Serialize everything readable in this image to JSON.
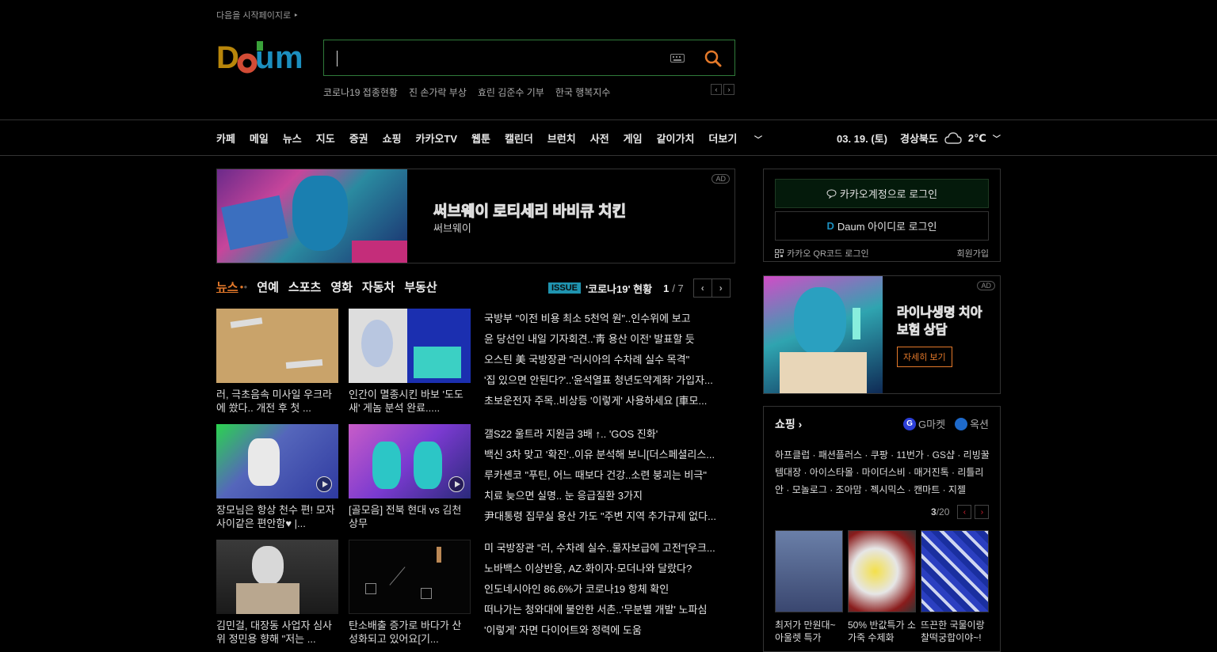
{
  "top": {
    "homepage_link": "다음을 시작페이지로",
    "search": {
      "placeholder": ""
    },
    "trending": [
      "코로나19 접종현황",
      "진 손가락 부상",
      "효린 김준수 기부",
      "한국 행복지수"
    ]
  },
  "gnb": {
    "menu": [
      "카페",
      "메일",
      "뉴스",
      "지도",
      "증권",
      "쇼핑",
      "카카오TV",
      "웹툰",
      "캘린더",
      "브런치",
      "사전",
      "게임",
      "같이가치",
      "더보기"
    ],
    "date": "03. 19. (토)",
    "region": "경상북도",
    "temperature": "2℃"
  },
  "ad_banner": {
    "badge": "AD",
    "title": "써브웨이 로티세리 바비큐 치킨",
    "sponsor": "써브웨이"
  },
  "news": {
    "tabs": [
      "뉴스",
      "연예",
      "스포츠",
      "영화",
      "자동차",
      "부동산"
    ],
    "issue_badge": "ISSUE",
    "issue_title": "'코로나19' 현황",
    "issue_page": "1",
    "issue_total": "/ 7",
    "thumbs": [
      "러, 극초음속 미사일 우크라에 쐈다.. 개전 후 첫 ...",
      "인간이 멸종시킨 바보 '도도새' 게놈 분석 완료.....",
      "장모님은 항상 천수 편! 모자사이같은 편안함♥ |...",
      "[골모음] 전북 현대 vs 김천 상무",
      "김민걸, 대장동 사업자 심사위 정민용 향해 \"저는 ...",
      "탄소배출 증가로 바다가 산성화되고 있어요[기..."
    ],
    "headlines": [
      [
        "국방부 \"이전 비용 최소 5천억 원\"..인수위에 보고",
        "윤 당선인 내일 기자회견..'靑 용산 이전' 발표할 듯",
        "오스틴 美 국방장관 \"러시아의 수차례 실수 목격\"",
        "'집 있으면 안된다?'..'윤석열표 청년도약계좌' 가입자...",
        "초보운전자 주목..비상등 '이렇게' 사용하세요 [車모..."
      ],
      [
        "갤S22 울트라 지원금 3배 ↑.. 'GOS 진화'",
        "백신 3차 맞고 '확진'..이유 분석해 보니[더스페셜리스...",
        "루카셴코 \"푸틴, 어느 때보다 건강..소련 붕괴는 비극\"",
        "치료 늦으면 실명.. 눈 응급질환 3가지",
        "尹대통령 집무실 용산 가도 \"주변 지역 추가규제 없다..."
      ],
      [
        "미 국방장관 \"러, 수차례 실수..물자보급에 고전\"[우크...",
        "노바백스 이상반응, AZ·화이자·모더나와 달랐다?",
        "인도네시아인 86.6%가 코로나19 항체 확인",
        "떠나가는 청와대에 불안한 서촌..'무분별 개발' 노파심",
        "'이렇게' 자면 다이어트와 정력에 도움"
      ]
    ]
  },
  "login": {
    "kakao": "카카오계정으로 로그인",
    "daum": "Daum 아이디로 로그인",
    "qr": "카카오 QR코드 로그인",
    "signup": "회원가입"
  },
  "side_ad": {
    "badge": "AD",
    "title": "라이나생명 치아보험 상담",
    "button": "자세히 보기"
  },
  "shopping": {
    "title": "쇼핑",
    "partners": [
      "G마켓",
      "옥션"
    ],
    "links": "하프클럽 · 패션플러스 · 쿠팡 · 11번가 · GS샵 · 리빙꿀템대장 · 아이스타몰 · 마이더스비 · 매거진톡 · 리틀리안 · 모놀로그 · 조아맘 · 젝시믹스 · 캔마트 · 지젤",
    "page": "3",
    "total": "/20",
    "products": [
      "최저가 만원대~ 아울렛 특가",
      "50% 반값특가 소가죽 수제화",
      "뜨끈한 국물이랑 찰떡궁합이야~!"
    ]
  },
  "colors": {
    "accent": "#e4792a",
    "issue": "#1f94b0",
    "search_border": "#2f7a3a"
  }
}
